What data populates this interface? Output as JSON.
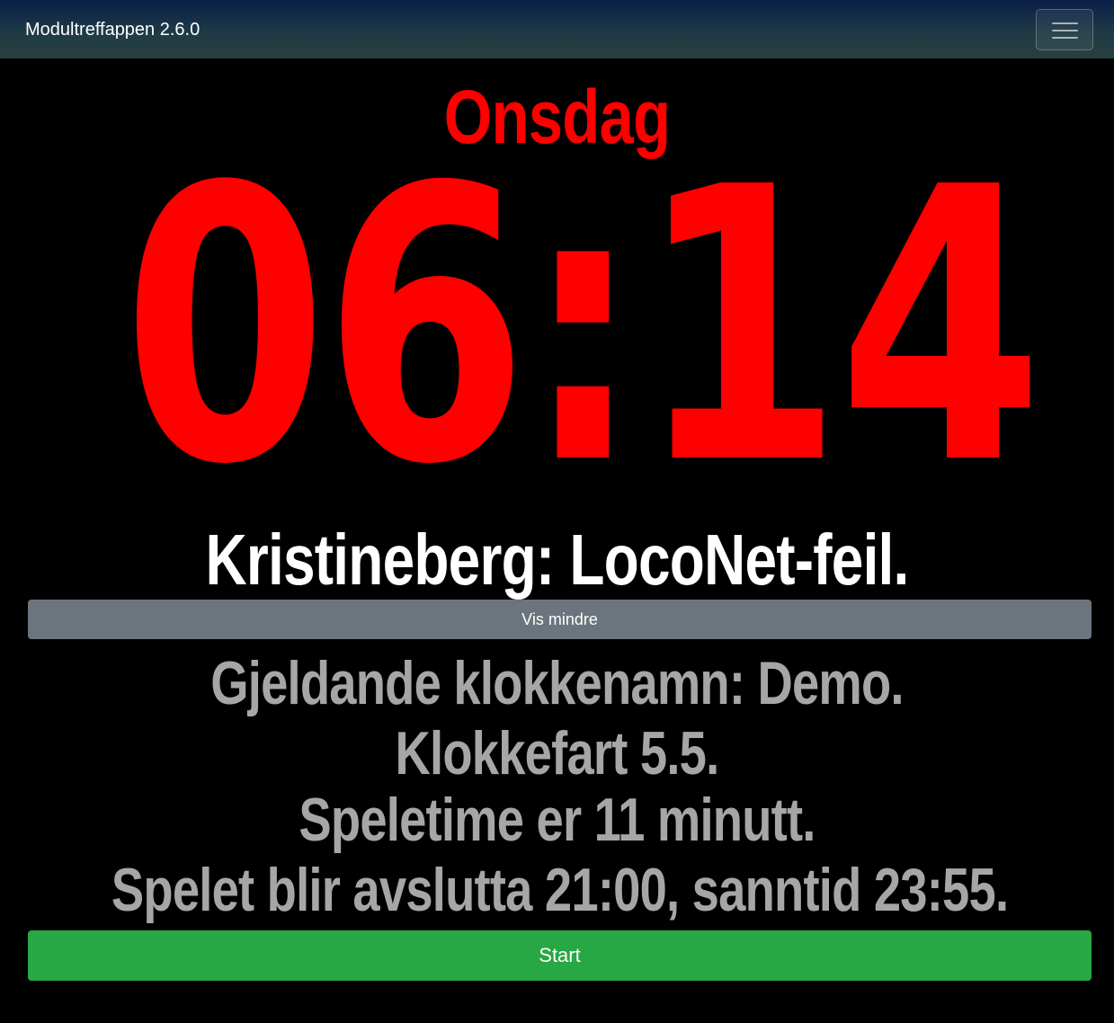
{
  "navbar": {
    "brand": "Modultreffappen 2.6.0",
    "menu_icon": "hamburger-menu-icon"
  },
  "clock": {
    "day": "Onsdag",
    "time": "06:14"
  },
  "message": "Kristineberg: LocoNet-feil.",
  "toggle_button": {
    "label": "Vis mindre"
  },
  "info": {
    "lines": [
      "Gjeldande klokkenamn: Demo.",
      "Klokkefart 5.5.",
      "Speletime er 11 minutt.",
      "Spelet blir avslutta 21:00, sanntid 23:55."
    ]
  },
  "start_button": {
    "label": "Start"
  },
  "colors": {
    "clock": "#ff0000",
    "message": "#ffffff",
    "info_text": "#a6a6a6",
    "toggle_button_bg": "#6c757d",
    "start_button_bg": "#28a745",
    "background": "#000000"
  }
}
